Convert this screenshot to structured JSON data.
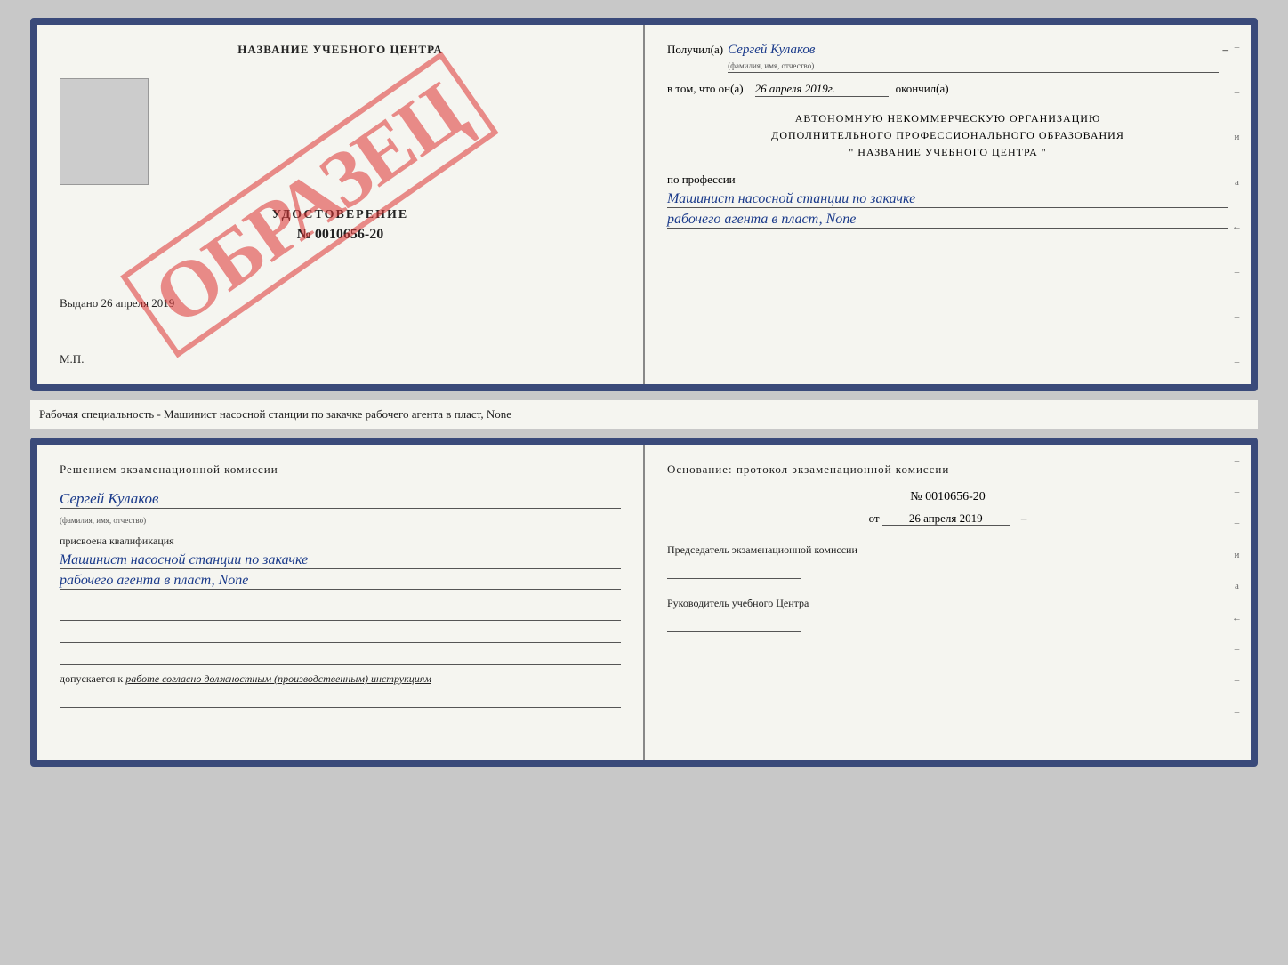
{
  "page": {
    "bg_color": "#c8c8c8"
  },
  "top_doc": {
    "left": {
      "center_title": "НАЗВАНИЕ УЧЕБНОГО ЦЕНТРА",
      "udostoverenie_label": "УДОСТОВЕРЕНИЕ",
      "udostoverenie_num": "№ 0010656-20",
      "vydano_label": "Выдано",
      "vydano_date": "26 апреля 2019",
      "mp_label": "М.П.",
      "obrazec": "ОБРАЗЕЦ"
    },
    "right": {
      "poluchil_label": "Получил(a)",
      "poluchil_name": "Сергей Кулаков",
      "familiya_hint": "(фамилия, имя, отчество)",
      "dash1": "–",
      "vtom_label": "в том, что он(а)",
      "vtom_date": "26 апреля 2019г.",
      "okonchil_label": "окончил(а)",
      "org_line1": "АВТОНОМНУЮ НЕКОММЕРЧЕСКУЮ ОРГАНИЗАЦИЮ",
      "org_line2": "ДОПОЛНИТЕЛЬНОГО ПРОФЕССИОНАЛЬНОГО ОБРАЗОВАНИЯ",
      "org_line3": "\"   НАЗВАНИЕ УЧЕБНОГО ЦЕНТРА   \"",
      "po_professii_label": "по профессии",
      "profession_line1": "Машинист насосной станции по закачке",
      "profession_line2": "рабочего агента в пласт, None"
    }
  },
  "separator": {
    "text": "Рабочая специальность - Машинист насосной станции по закачке рабочего агента в пласт, None"
  },
  "bottom_doc": {
    "left": {
      "resheniem_title": "Решением экзаменационной комиссии",
      "name": "Сергей Кулаков",
      "familiya_hint": "(фамилия, имя, отчество)",
      "prisvoena_label": "присвоена квалификация",
      "qualification_line1": "Машинист насосной станции по закачке",
      "qualification_line2": "рабочего агента в пласт, None",
      "dopuskaetsya_prefix": "допускается к",
      "dopuskaetsya_italic": "работе согласно должностным (производственным) инструкциям"
    },
    "right": {
      "osnov_title": "Основание: протокол экзаменационной комиссии",
      "protocol_num": "№ 0010656-20",
      "ot_label": "от",
      "ot_date": "26 апреля 2019",
      "predsedatel_title": "Председатель экзаменационной комиссии",
      "rukovoditel_title": "Руководитель учебного Центра"
    }
  }
}
